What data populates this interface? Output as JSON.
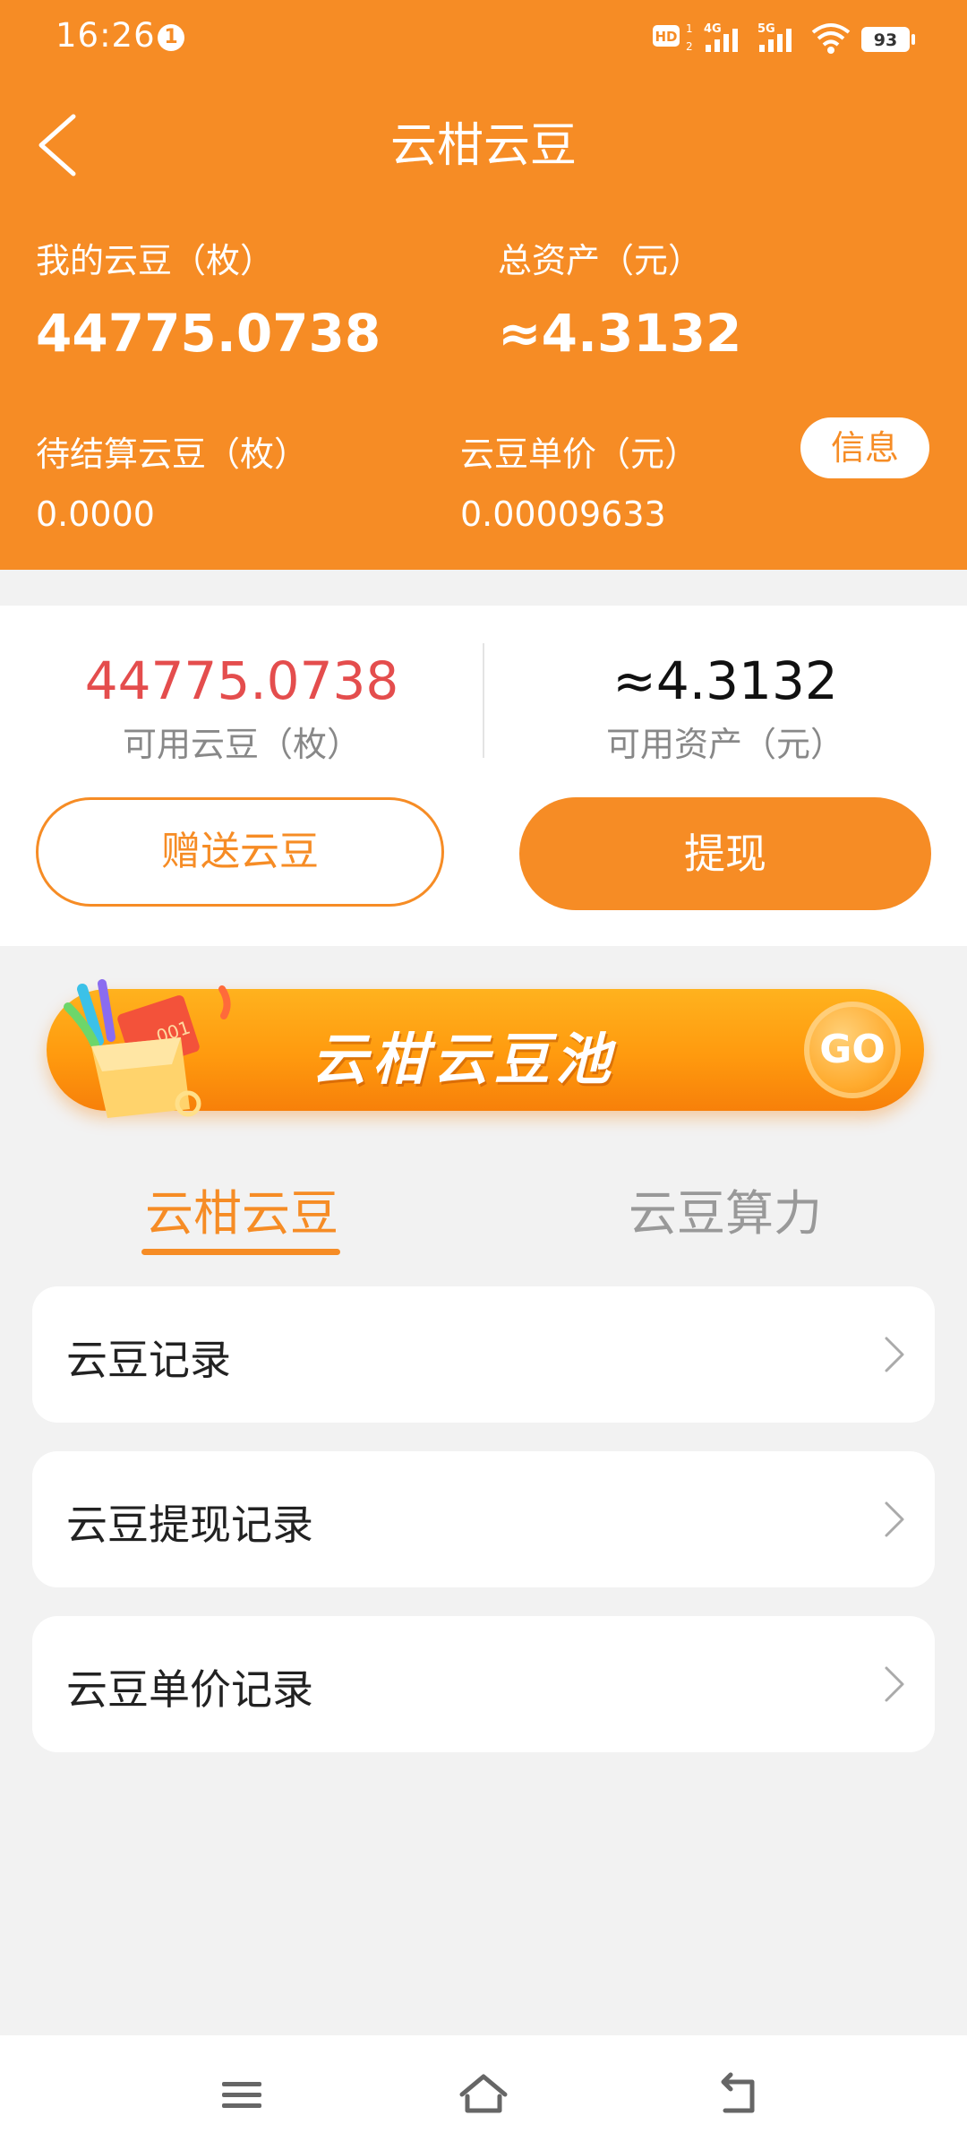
{
  "status_bar": {
    "time": "16:26",
    "notification_count": "1",
    "battery": "93",
    "network_labels": [
      "HD",
      "4G",
      "5G"
    ]
  },
  "header": {
    "title": "云柑云豆",
    "my_beans_label": "我的云豆（枚）",
    "my_beans_value": "44775.0738",
    "total_assets_label": "总资产（元）",
    "total_assets_value": "≈4.3132",
    "pending_label": "待结算云豆（枚）",
    "pending_value": "0.0000",
    "unit_price_label": "云豆单价（元）",
    "unit_price_value": "0.00009633",
    "info_button": "信息"
  },
  "balance": {
    "available_beans_value": "44775.0738",
    "available_beans_label": "可用云豆（枚）",
    "available_assets_value": "≈4.3132",
    "available_assets_label": "可用资产（元）",
    "gift_button": "赠送云豆",
    "withdraw_button": "提现"
  },
  "banner": {
    "title": "云柑云豆池",
    "go_label": "GO"
  },
  "tabs": [
    {
      "label": "云柑云豆",
      "active": true
    },
    {
      "label": "云豆算力",
      "active": false
    }
  ],
  "list": [
    {
      "label": "云豆记录"
    },
    {
      "label": "云豆提现记录"
    },
    {
      "label": "云豆单价记录"
    }
  ],
  "colors": {
    "accent": "#f68c25",
    "highlight_red": "#e44d4d",
    "background": "#f2f2f2"
  },
  "icons": {
    "back": "back-arrow-icon",
    "chevron": "chevron-right-icon",
    "nav_menu": "menu-icon",
    "nav_home": "home-icon",
    "nav_back": "return-icon"
  }
}
